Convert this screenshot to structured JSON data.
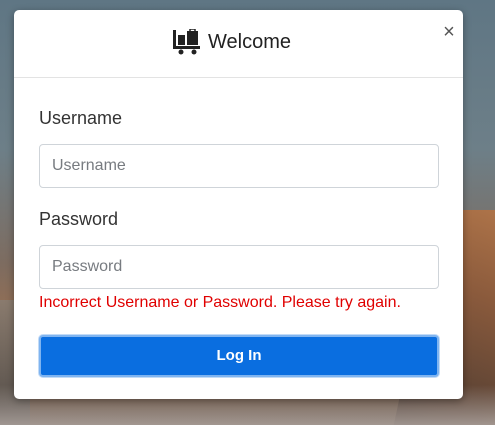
{
  "modal": {
    "title": "Welcome",
    "title_icon": "luggage-cart-icon",
    "close_label": "×"
  },
  "form": {
    "username_label": "Username",
    "username_placeholder": "Username",
    "username_value": "",
    "password_label": "Password",
    "password_placeholder": "Password",
    "password_value": "",
    "error_message": "Incorrect Username or Password. Please try again.",
    "login_label": "Log In"
  },
  "colors": {
    "accent": "#0a6ee0",
    "error": "#e00000"
  }
}
